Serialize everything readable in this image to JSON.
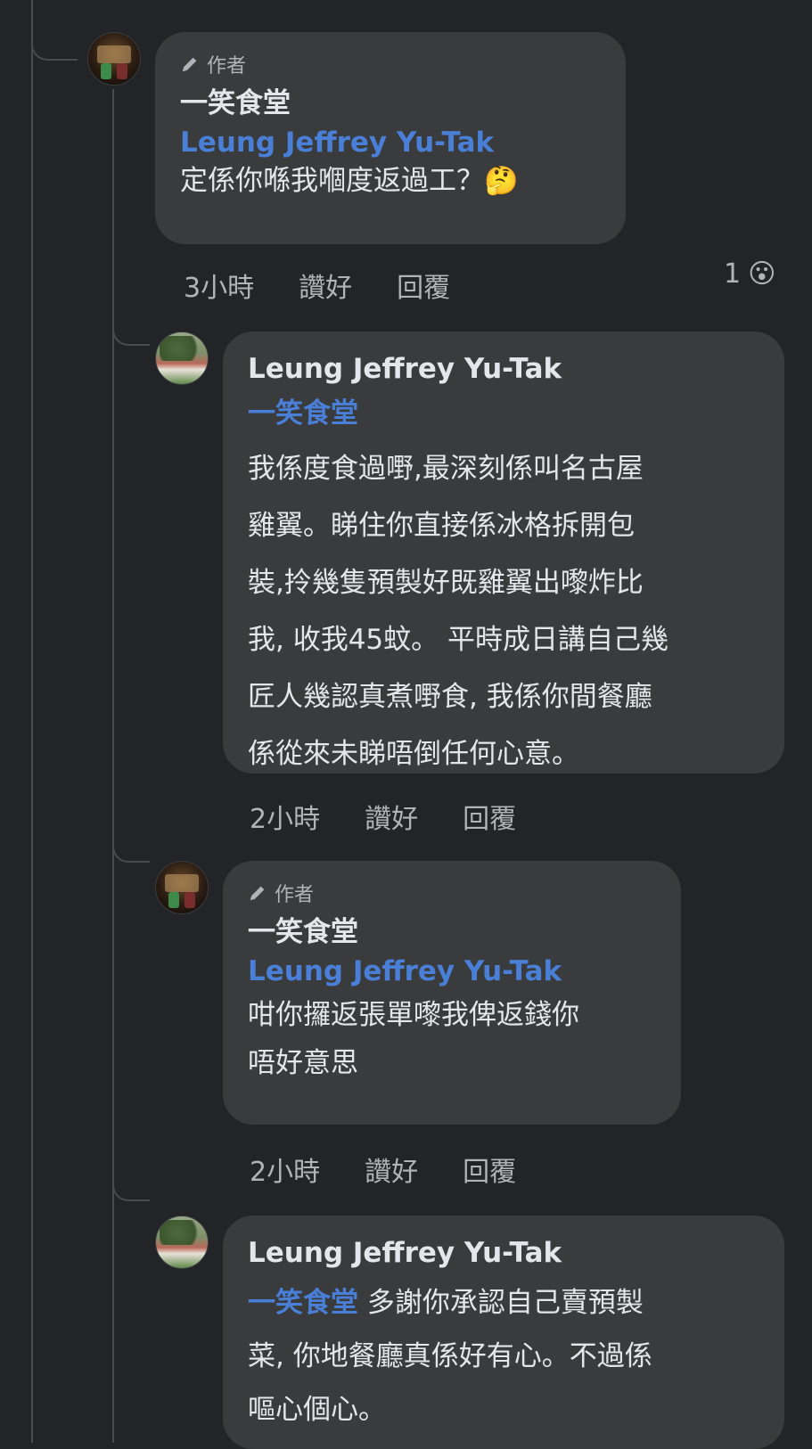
{
  "comments": [
    {
      "author_badge": "作者",
      "name": "一笑食堂",
      "mention": "Leung Jeffrey Yu-Tak",
      "text": "定係你喺我嗰度返過工？",
      "emoji": "🤔",
      "time": "3小時",
      "like": "讚好",
      "reply": "回覆",
      "reaction_count": "1",
      "reaction_emoji": "😮"
    },
    {
      "name": "Leung Jeffrey Yu-Tak",
      "mention": "一笑食堂",
      "text_lines": [
        "我係度食過嘢,最深刻係叫名古屋",
        "雞翼。睇住你直接係冰格拆開包",
        "裝,拎幾隻預製好既雞翼出嚟炸比",
        "我, 收我45蚊。 平時成日講自己幾",
        "匠人幾認真煮嘢食, 我係你間餐廳",
        "係從來未睇唔倒任何心意。"
      ],
      "time": "2小時",
      "like": "讚好",
      "reply": "回覆"
    },
    {
      "author_badge": "作者",
      "name": "一笑食堂",
      "mention": "Leung Jeffrey Yu-Tak",
      "text_lines": [
        "咁你攞返張單嚟我俾返錢你",
        "唔好意思"
      ],
      "time": "2小時",
      "like": "讚好",
      "reply": "回覆"
    },
    {
      "name": "Leung Jeffrey Yu-Tak",
      "mention": "一笑食堂",
      "first_line_rest": " 多謝你承認自己賣預製",
      "text_lines": [
        "菜, 你地餐廳真係好有心。不過係",
        "嘔心個心。"
      ]
    }
  ]
}
